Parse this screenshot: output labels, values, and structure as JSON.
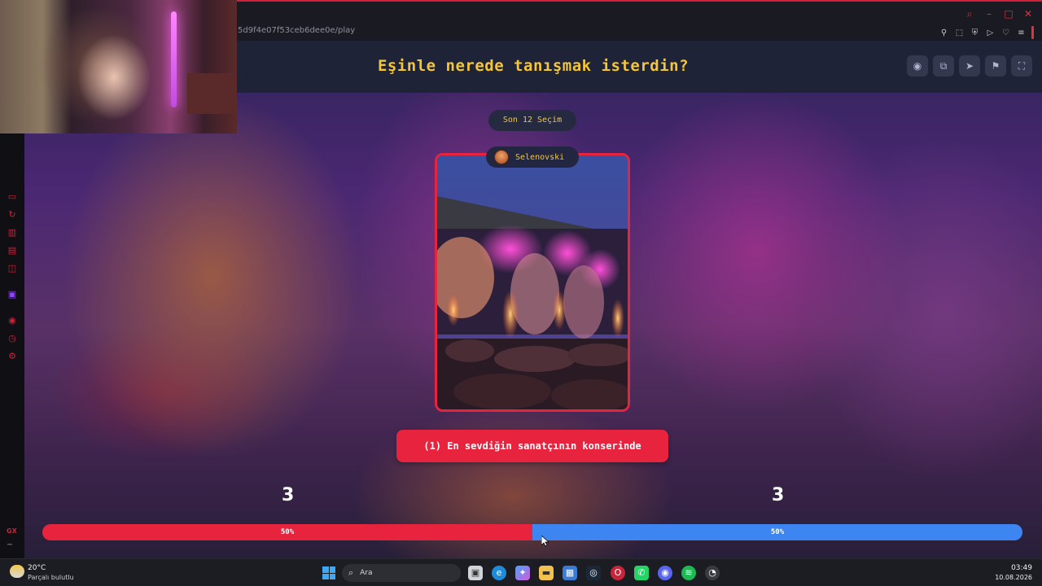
{
  "browser": {
    "url_fragment": "5d9f4e07f53ceb6dee0e/play"
  },
  "game": {
    "question": "Eşinle nerede tanışmak isterdin?",
    "recent_label": "Son 12 Seçim",
    "user_name": "Selenovski",
    "answer": "(1) En sevdiğin sanatçının konserinde",
    "left_count": "3",
    "right_count": "3",
    "left_percent_label": "50%",
    "right_percent_label": "50%",
    "left_fraction": 0.5,
    "colors": {
      "accent_yellow": "#f3c53a",
      "answer_red": "#e8233d",
      "bar_blue": "#3d85f0",
      "header_bg": "#1f2338"
    },
    "toolbar_icons": [
      "eye-icon",
      "share-icon",
      "send-icon",
      "flag-icon",
      "fullscreen-icon"
    ]
  },
  "sidebar_icons": [
    "gaming-icon",
    "refresh-icon",
    "bag-icon",
    "chat-icon",
    "messenger-icon",
    "twitch-icon",
    "record-icon",
    "clock-icon",
    "settings-icon"
  ],
  "sidebar_gx_label": "GX",
  "taskbar": {
    "weather_temp": "20°C",
    "weather_desc": "Parçalı bulutlu",
    "search_placeholder": "Ara",
    "time": "03:49",
    "date": "10.08.2026"
  }
}
